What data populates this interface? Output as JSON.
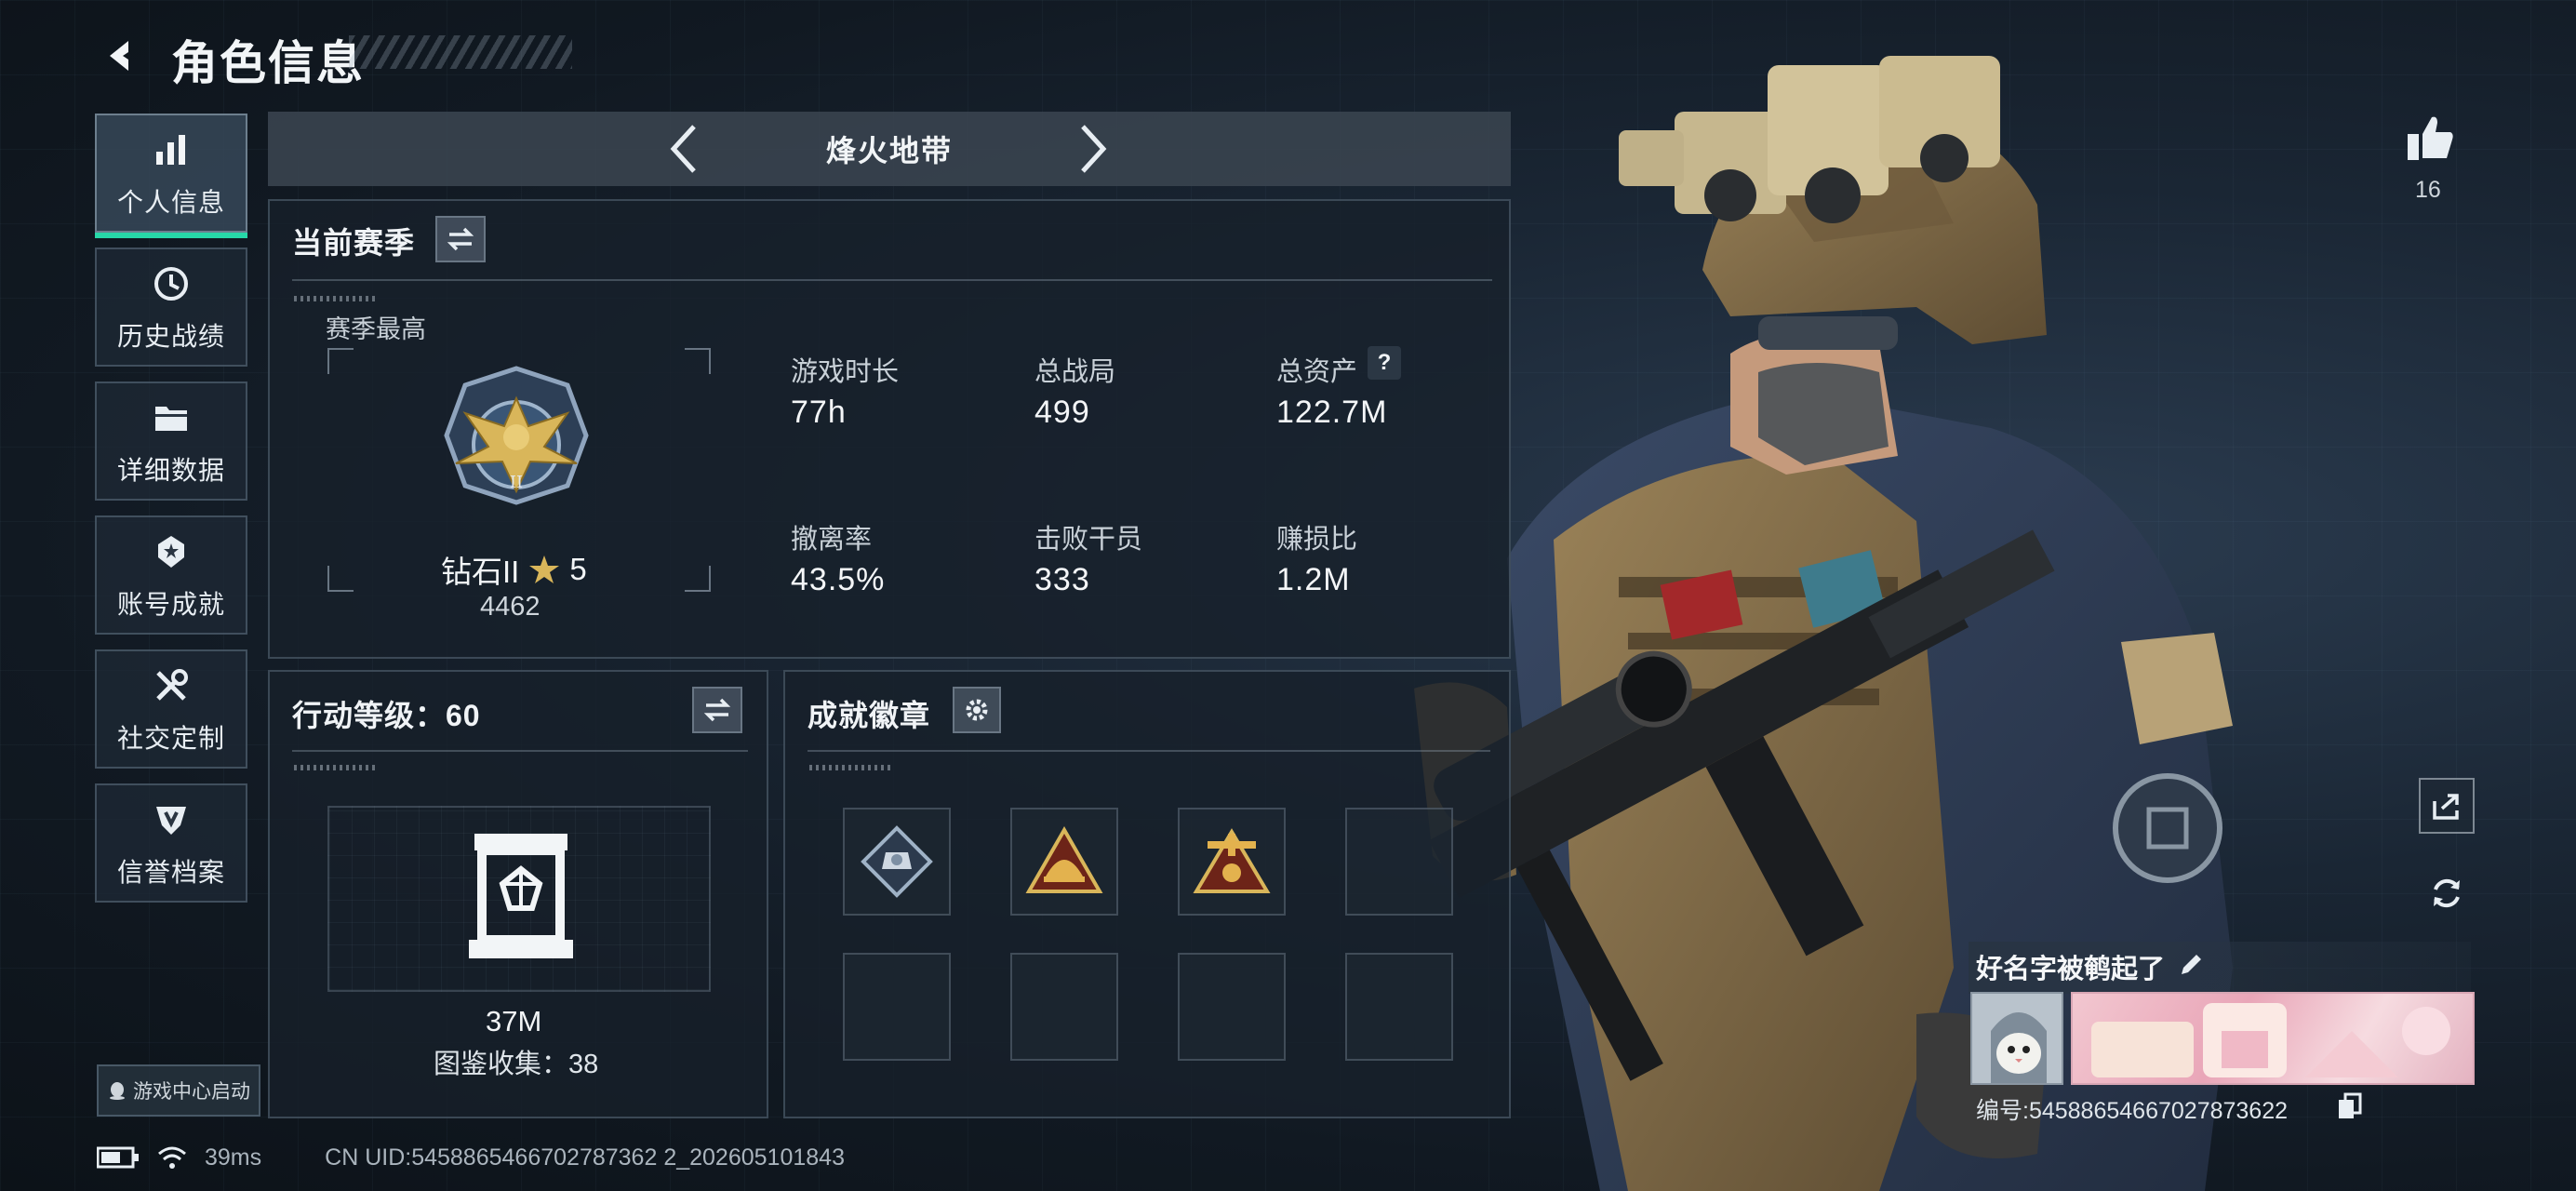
{
  "header": {
    "title": "角色信息"
  },
  "sidebar": {
    "items": [
      {
        "label": "个人信息",
        "icon": "bar-chart-icon",
        "active": true
      },
      {
        "label": "历史战绩",
        "icon": "history-icon"
      },
      {
        "label": "详细数据",
        "icon": "folder-icon"
      },
      {
        "label": "账号成就",
        "icon": "achievement-icon"
      },
      {
        "label": "社交定制",
        "icon": "tools-icon"
      },
      {
        "label": "信誉档案",
        "icon": "shield-icon"
      }
    ],
    "game_center": "游戏中心启动"
  },
  "mode": {
    "title": "烽火地带"
  },
  "season": {
    "title": "当前赛季",
    "highest_label": "赛季最高",
    "rank_name": "钻石II",
    "rank_stars": "5",
    "rank_score": "4462",
    "stats": [
      {
        "label": "游戏时长",
        "value": "77h"
      },
      {
        "label": "总战局",
        "value": "499"
      },
      {
        "label": "总资产",
        "value": "122.7M",
        "help": "?"
      },
      {
        "label": "撤离率",
        "value": "43.5%"
      },
      {
        "label": "击败干员",
        "value": "333"
      },
      {
        "label": "赚损比",
        "value": "1.2M"
      }
    ]
  },
  "action_level": {
    "title": "行动等级：60",
    "value": "37M",
    "collection": "图鉴收集：38"
  },
  "achievements": {
    "title": "成就徽章",
    "badges": [
      "diamond-badge-icon",
      "helmet-badge-icon",
      "crest-badge-icon",
      "",
      "",
      "",
      "",
      ""
    ]
  },
  "profile": {
    "likes": "16",
    "player_name": "好名字被鹌起了",
    "player_id": "编号:5458865466702787362​2"
  },
  "status": {
    "ping": "39ms",
    "uid": "CN UID:5458865466702787362 2_202605101843"
  },
  "colors": {
    "accent": "#27d8a8",
    "gold": "#d9b65a"
  }
}
